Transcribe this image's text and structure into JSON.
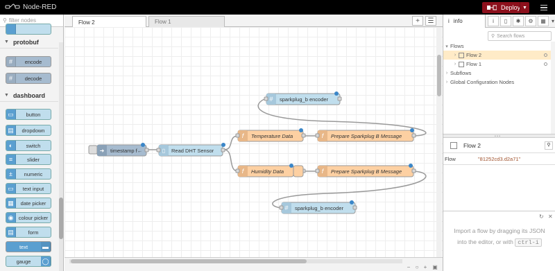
{
  "header": {
    "app_title": "Node-RED",
    "deploy_label": "Deploy"
  },
  "palette": {
    "search_placeholder": "filter nodes",
    "categories": [
      {
        "label": "protobuf",
        "nodes": [
          "encode",
          "decode"
        ]
      },
      {
        "label": "dashboard",
        "nodes": [
          "button",
          "dropdown",
          "switch",
          "slider",
          "numeric",
          "text input",
          "date picker",
          "colour picker",
          "form",
          "text",
          "gauge"
        ]
      }
    ]
  },
  "tabs": [
    {
      "label": "Flow 2",
      "active": true
    },
    {
      "label": "Flow 1",
      "active": false
    }
  ],
  "flow": {
    "nodes": [
      "sparkplug_b encoder",
      "timestamp f←",
      "Read DHT Sensor",
      "Temperature Data",
      "Prepare Sparkplug B Message",
      "Humidity Data",
      "Prepare Sparkplug B Message",
      "sparkplug_b encoder"
    ]
  },
  "sidebar": {
    "info_tab": "info",
    "search_placeholder": "Search flows",
    "tree": {
      "root": "Flows",
      "items": [
        "Flow 2",
        "Flow 1"
      ],
      "subflows": "Subflows",
      "global": "Global Configuration Nodes"
    },
    "props_title": "Flow 2",
    "prop_key": "Flow",
    "prop_value": "\"81252cd3.d2a71\"",
    "hint_line1": "Import a flow by dragging its JSON",
    "hint_line2": "into the editor, or with",
    "hint_code": "ctrl-i"
  },
  "colors": {
    "header": "#000000",
    "deploy": "#8c101c",
    "function_node": "#fdd0a2",
    "dashboard_node": "#c0deed",
    "selected_row": "#ffebc7"
  }
}
